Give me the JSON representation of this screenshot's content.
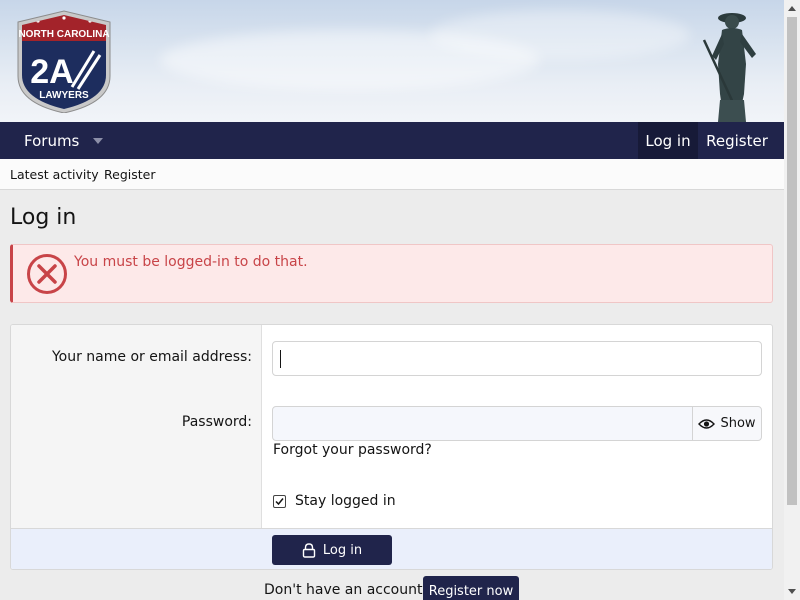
{
  "logo": {
    "top_text": "NORTH CAROLINA",
    "mark": "2A",
    "bottom_text": "LAWYERS"
  },
  "nav": {
    "forums_label": "Forums",
    "login_label": "Log in",
    "register_label": "Register"
  },
  "subnav": {
    "items": [
      "Latest activity",
      "Register"
    ]
  },
  "page": {
    "title": "Log in"
  },
  "error": {
    "message": "You must be logged-in to do that."
  },
  "login_form": {
    "name_label": "Your name or email address:",
    "name_value": "",
    "password_label": "Password:",
    "password_value": "",
    "show_label": "Show",
    "forgot_label": "Forgot your password?",
    "stay_label": "Stay logged in",
    "stay_checked": true,
    "submit_label": "Log in"
  },
  "register": {
    "prompt": "Don't have an account?",
    "button_label": "Register now"
  },
  "colors": {
    "nav_bg": "#20244b",
    "error_text": "#c84448",
    "error_bg": "#fde9e9"
  }
}
